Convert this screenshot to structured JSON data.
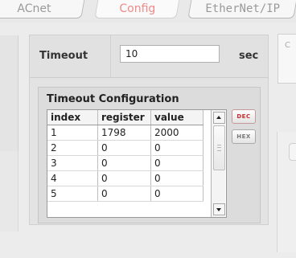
{
  "tabs": [
    {
      "label": "ACnet"
    },
    {
      "label": "Config",
      "active": true
    },
    {
      "label": "EtherNet/IP"
    }
  ],
  "side_panel": {
    "letter": "C"
  },
  "timeout": {
    "label": "Timeout",
    "value": "10",
    "unit": "sec"
  },
  "timeout_config": {
    "title": "Timeout Configuration",
    "columns": [
      "index",
      "register",
      "value"
    ],
    "rows": [
      [
        "1",
        "1798",
        "2000"
      ],
      [
        "2",
        "0",
        "0"
      ],
      [
        "3",
        "0",
        "0"
      ],
      [
        "4",
        "0",
        "0"
      ],
      [
        "5",
        "0",
        "0"
      ]
    ],
    "buttons": {
      "dec": "DEC",
      "hex": "HEX"
    }
  }
}
